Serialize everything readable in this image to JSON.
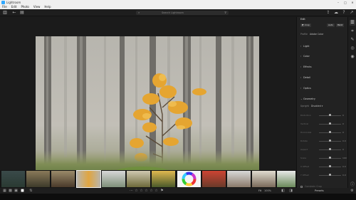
{
  "window": {
    "title": "Lightroom"
  },
  "menu": [
    "File",
    "Edit",
    "Photo",
    "View",
    "Help"
  ],
  "search": {
    "placeholder": "Search Lightroom"
  },
  "panel": {
    "title": "Edit",
    "auto_label": "Auto",
    "bw_label": "B&W",
    "profile_label": "Profile",
    "profile_value": "Adobe Color",
    "sections": [
      "Light",
      "Color",
      "Effects",
      "Detail",
      "Optics",
      "Geometry"
    ],
    "upright_label": "Upright",
    "upright_value": "Disabled",
    "sliders": [
      {
        "label": "Distortion",
        "value": "0",
        "pos": 0.5
      },
      {
        "label": "Vertical",
        "value": "0",
        "pos": 0.5
      },
      {
        "label": "Horizontal",
        "value": "0",
        "pos": 0.5
      },
      {
        "label": "Rotate",
        "value": "0.0",
        "pos": 0.5
      },
      {
        "label": "Aspect",
        "value": "0",
        "pos": 0.5
      },
      {
        "label": "Scale",
        "value": "100",
        "pos": 0.5
      },
      {
        "label": "X Offset",
        "value": "0.0",
        "pos": 0.5
      },
      {
        "label": "Y Offset",
        "value": "0.0",
        "pos": 0.5
      }
    ],
    "constrain_label": "Constrain Crop"
  },
  "bottom": {
    "fit": "Fit",
    "zoom": "100%",
    "presets": "Presets"
  },
  "colors": {
    "accent": "#31a8ff"
  }
}
